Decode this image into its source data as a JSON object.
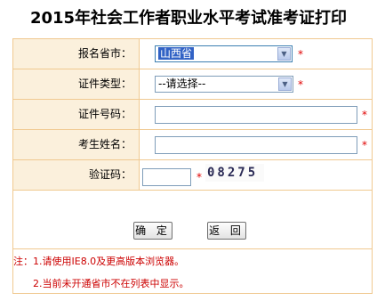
{
  "page_title": "2015年社会工作者职业水平考试准考证打印",
  "form": {
    "province": {
      "label": "报名省市：",
      "selected": "山西省",
      "required_mark": "*"
    },
    "id_type": {
      "label": "证件类型：",
      "selected": "--请选择--",
      "required_mark": "*"
    },
    "id_number": {
      "label": "证件号码：",
      "value": "",
      "required_mark": "*"
    },
    "name": {
      "label": "考生姓名：",
      "value": "",
      "required_mark": "*"
    },
    "captcha": {
      "label": "验证码：",
      "value": "",
      "required_mark": "*",
      "image_text": "08275"
    }
  },
  "buttons": {
    "confirm": "确 定",
    "back": "返 回"
  },
  "notes": {
    "line1": "注：1.请使用IE8.0及更高版本浏览器。",
    "line2": "2.当前未开通省市不在列表中显示。"
  },
  "colors": {
    "border": "#f0c990",
    "label_bg": "#fbf0dc",
    "required": "#e00000",
    "note": "#cc0000"
  },
  "icons": [
    "dropdown-arrow-icon"
  ]
}
